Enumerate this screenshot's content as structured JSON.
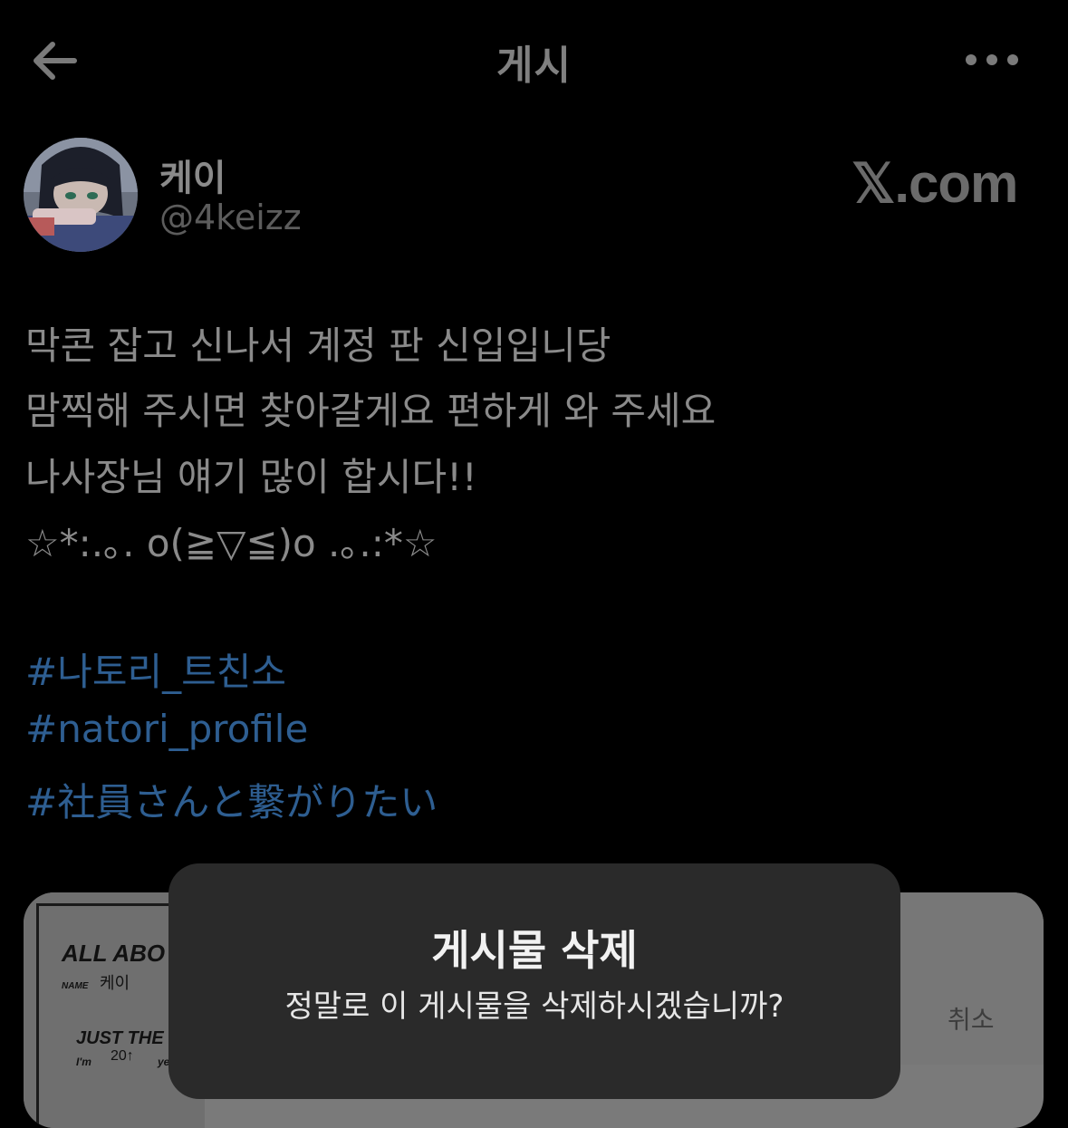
{
  "header": {
    "title": "게시",
    "back_icon": "arrow-left-icon",
    "more_icon": "more-horizontal-icon"
  },
  "author": {
    "name": "케이",
    "handle": "@4keizz"
  },
  "watermark": "𝕏.com",
  "tweet": {
    "lines": [
      "막콘 잡고 신나서 계정 판 신입입니당",
      "맘찍해 주시면 찾아갈게요 편하게 와 주세요",
      "나사장님 얘기 많이 합시다!!",
      "☆*:.｡. o(≧▽≦)o .｡.:*☆"
    ],
    "hashtags": [
      "#나토리_트친소",
      "#natori_profile",
      "#社員さんと繋がりたい"
    ]
  },
  "media": {
    "paper_heading": "ALL ABO",
    "paper_name_label": "NAME",
    "paper_name_value": "케이",
    "paper_subheading": "JUST THE",
    "paper_im_label": "I'm",
    "paper_age_value": "20↑",
    "paper_age_suffix": "ye"
  },
  "dialog": {
    "title": "게시물 삭제",
    "message": "정말로 이 게시물을 삭제하시겠습니까?",
    "cancel_label": "취소"
  },
  "colors": {
    "background": "#000000",
    "hashtag": "#2e5e91",
    "dialog_bg": "#2a2a2a"
  }
}
